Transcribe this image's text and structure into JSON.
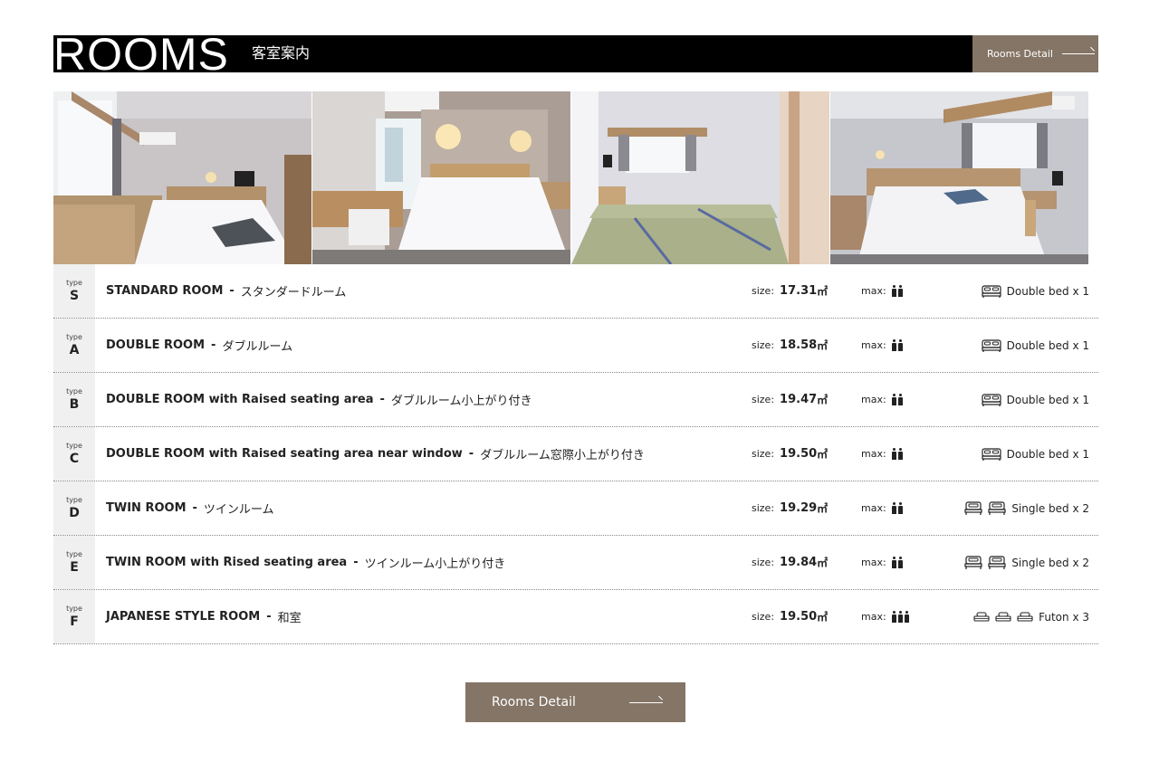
{
  "header": {
    "title": "ROOMS",
    "subtitle": "客室案内",
    "detail_button": "Rooms Detail"
  },
  "photos": [
    {
      "icon": "standard-room-photo"
    },
    {
      "icon": "double-room-photo"
    },
    {
      "icon": "japanese-style-room-photo"
    },
    {
      "icon": "twin-room-photo"
    }
  ],
  "rooms": [
    {
      "type_label": "type",
      "code": "S",
      "name": "STANDARD ROOM",
      "sep": "-",
      "name_jp": "スタンダードルーム",
      "size_label": "size:",
      "size": "17.31",
      "unit": "㎡",
      "max_label": "max:",
      "max_persons": 2,
      "bed_icon": "double-bed-icon",
      "bed_count": 1,
      "bed": "Double bed x 1"
    },
    {
      "type_label": "type",
      "code": "A",
      "name": "DOUBLE ROOM",
      "sep": "-",
      "name_jp": "ダブルルーム",
      "size_label": "size:",
      "size": "18.58",
      "unit": "㎡",
      "max_label": "max:",
      "max_persons": 2,
      "bed_icon": "double-bed-icon",
      "bed_count": 1,
      "bed": "Double bed x 1"
    },
    {
      "type_label": "type",
      "code": "B",
      "name": "DOUBLE ROOM with Raised seating area",
      "sep": "-",
      "name_jp": "ダブルルーム小上がり付き",
      "size_label": "size:",
      "size": "19.47",
      "unit": "㎡",
      "max_label": "max:",
      "max_persons": 2,
      "bed_icon": "double-bed-icon",
      "bed_count": 1,
      "bed": "Double bed x 1"
    },
    {
      "type_label": "type",
      "code": "C",
      "name": "DOUBLE ROOM with Raised seating area near window",
      "sep": "-",
      "name_jp": "ダブルルーム窓際小上がり付き",
      "size_label": "size:",
      "size": "19.50",
      "unit": "㎡",
      "max_label": "max:",
      "max_persons": 2,
      "bed_icon": "double-bed-icon",
      "bed_count": 1,
      "bed": "Double bed x 1"
    },
    {
      "type_label": "type",
      "code": "D",
      "name": "TWIN ROOM",
      "sep": "-",
      "name_jp": "ツインルーム",
      "size_label": "size:",
      "size": "19.29",
      "unit": "㎡",
      "max_label": "max:",
      "max_persons": 2,
      "bed_icon": "single-bed-icon",
      "bed_count": 2,
      "bed": "Single bed x 2"
    },
    {
      "type_label": "type",
      "code": "E",
      "name": "TWIN ROOM with Rised seating area",
      "sep": "-",
      "name_jp": "ツインルーム小上がり付き",
      "size_label": "size:",
      "size": "19.84",
      "unit": "㎡",
      "max_label": "max:",
      "max_persons": 2,
      "bed_icon": "single-bed-icon",
      "bed_count": 2,
      "bed": "Single bed x 2"
    },
    {
      "type_label": "type",
      "code": "F",
      "name": "JAPANESE STYLE ROOM",
      "sep": "-",
      "name_jp": "和室",
      "size_label": "size:",
      "size": "19.50",
      "unit": "㎡",
      "max_label": "max:",
      "max_persons": 3,
      "bed_icon": "futon-icon",
      "bed_count": 3,
      "bed": "Futon x 3"
    }
  ],
  "footer": {
    "detail_button": "Rooms Detail"
  },
  "colors": {
    "header_bg": "#000000",
    "button_bg": "#847566",
    "type_cell_bg": "#f0f0f0"
  }
}
